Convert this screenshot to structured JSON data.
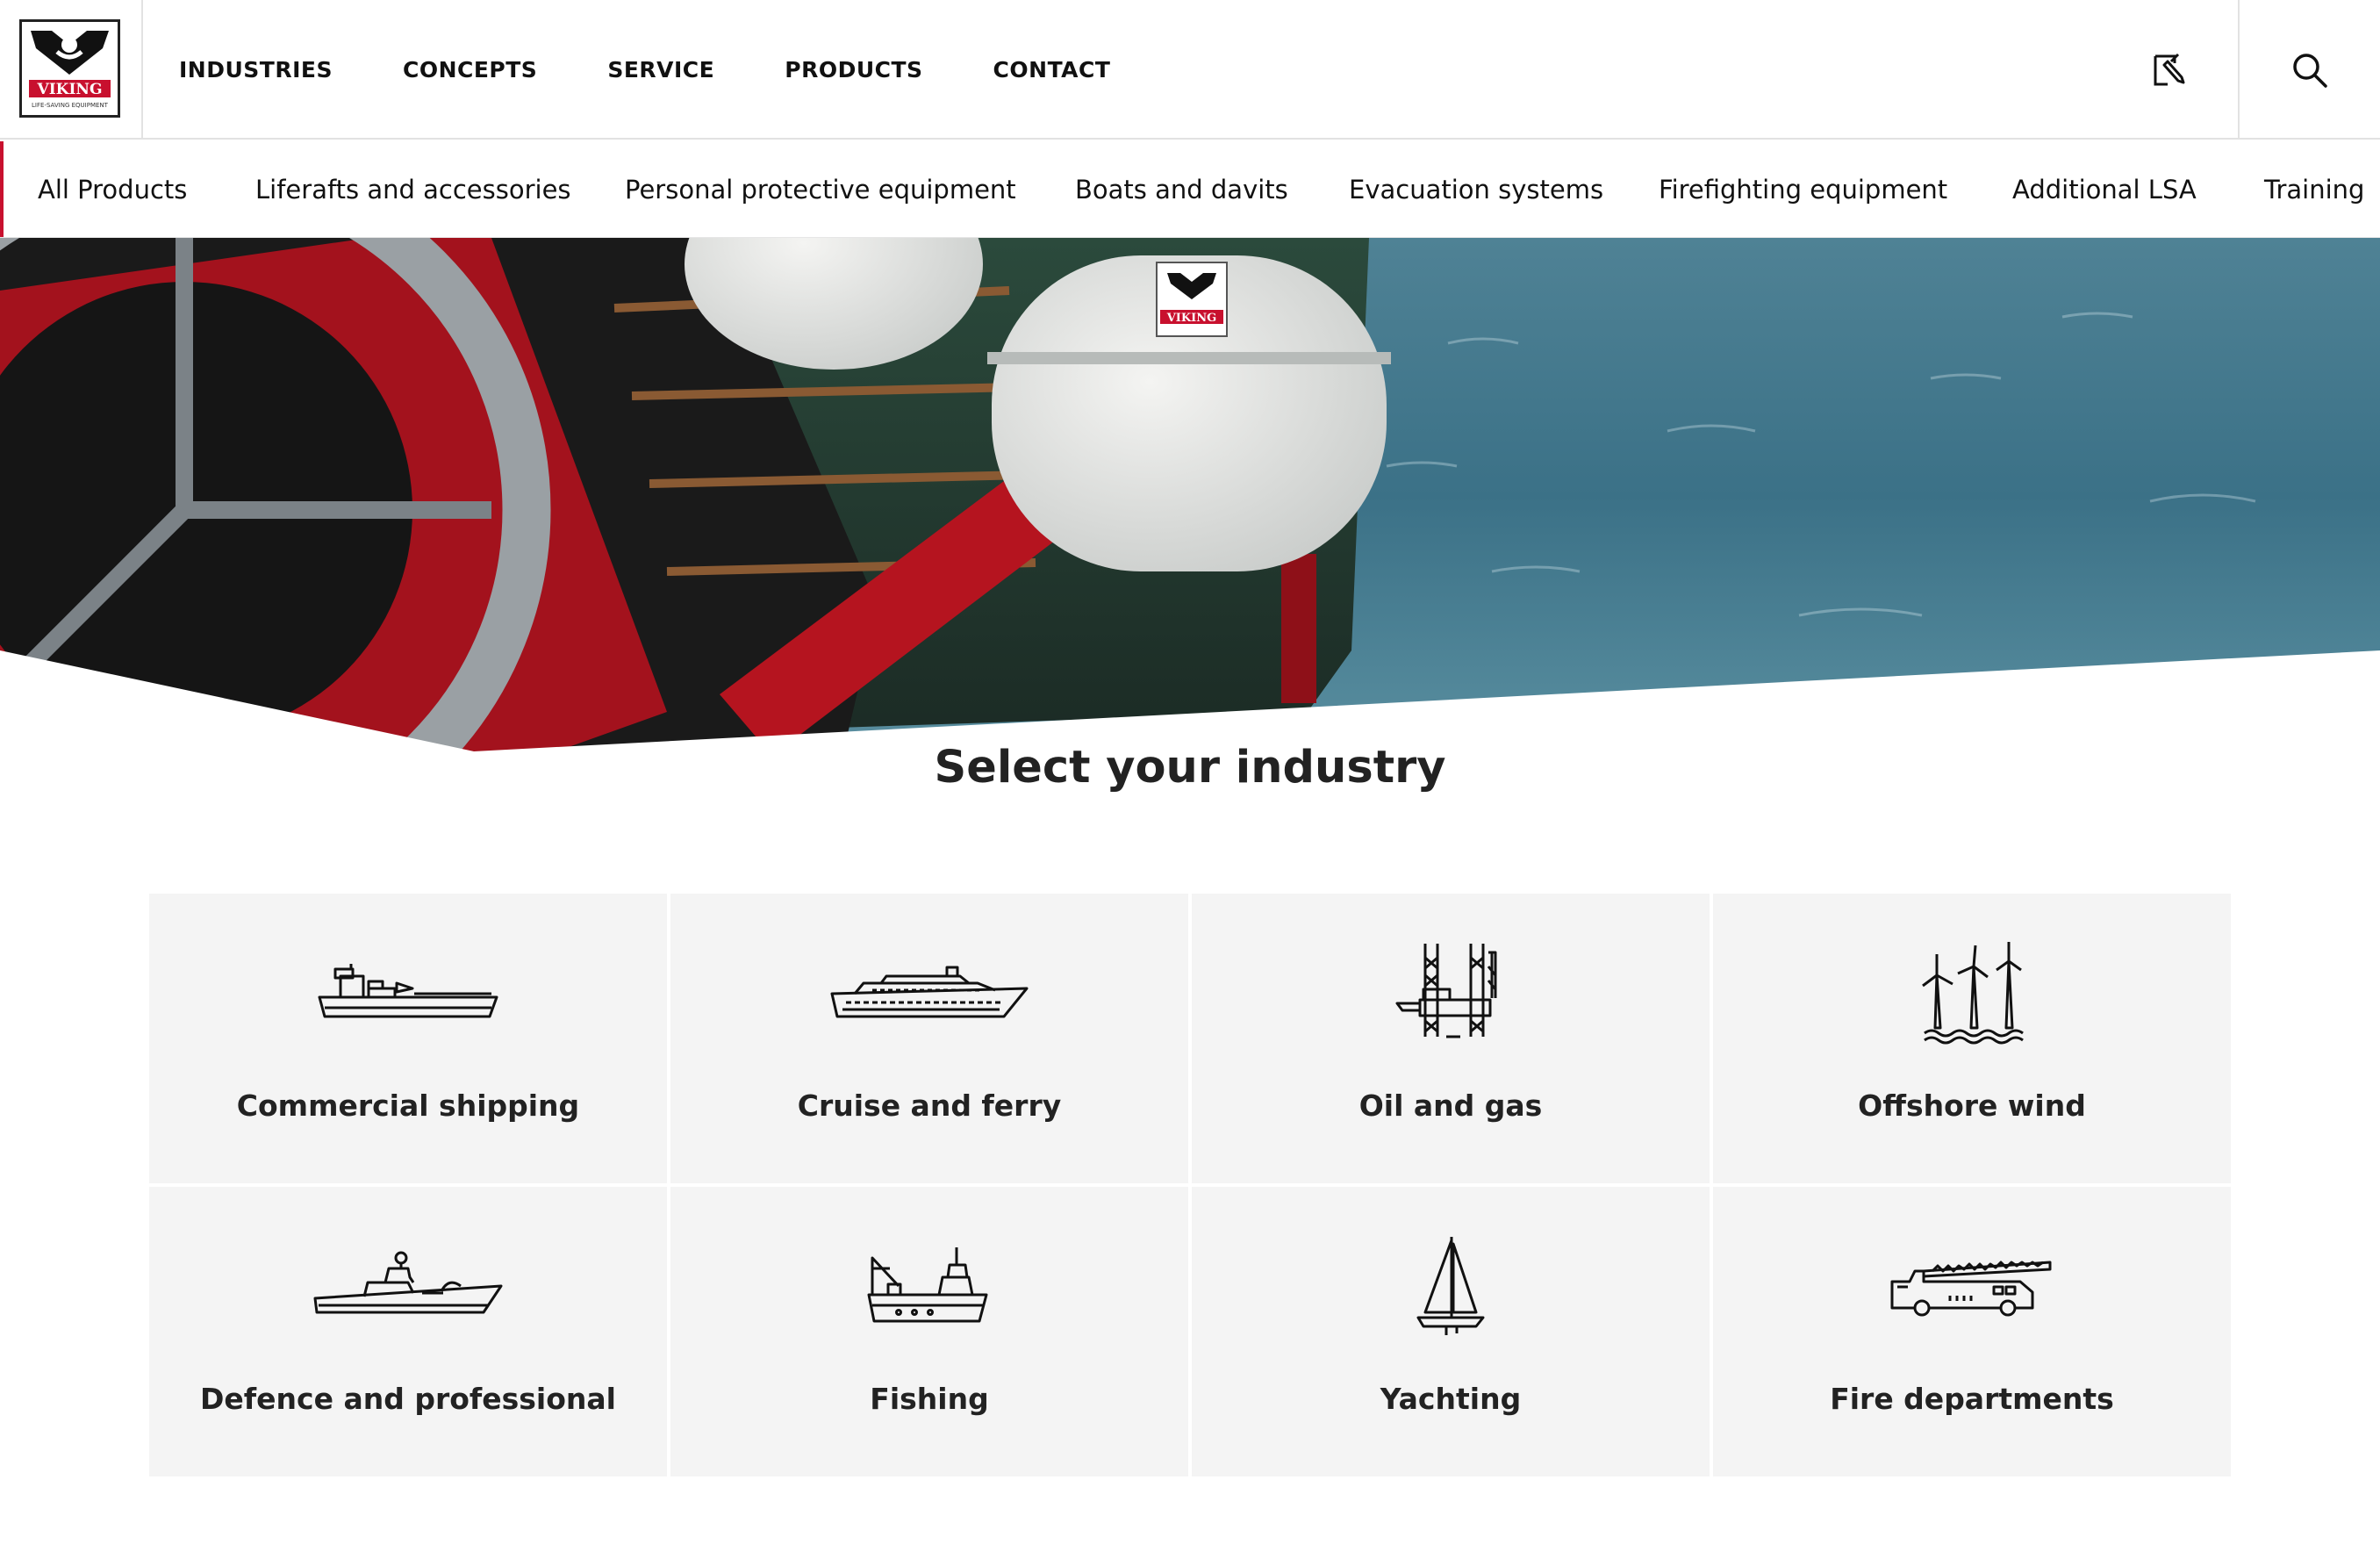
{
  "header": {
    "logo": {
      "brand_text": "VIKING",
      "tagline": "LIFE-SAVING EQUIPMENT",
      "icon": "viking-logo"
    },
    "nav": [
      {
        "label": "INDUSTRIES"
      },
      {
        "label": "CONCEPTS"
      },
      {
        "label": "SERVICE"
      },
      {
        "label": "PRODUCTS"
      },
      {
        "label": "CONTACT"
      }
    ],
    "icons": {
      "edit": "edit-document-icon",
      "search": "search-icon"
    }
  },
  "subnav": {
    "items": [
      {
        "label": "All Products"
      },
      {
        "label": "Liferafts and accessories"
      },
      {
        "label": "Personal protective equipment"
      },
      {
        "label": "Boats and davits"
      },
      {
        "label": "Evacuation systems"
      },
      {
        "label": "Firefighting equipment"
      },
      {
        "label": "Additional LSA"
      },
      {
        "label": "Training"
      }
    ]
  },
  "hero": {
    "raft_logo_text": "VIKING"
  },
  "main": {
    "title": "Select your industry",
    "industries": [
      {
        "label": "Commercial shipping",
        "icon": "cargo-ship-icon"
      },
      {
        "label": "Cruise and ferry",
        "icon": "cruise-ship-icon"
      },
      {
        "label": "Oil and gas",
        "icon": "oil-rig-icon"
      },
      {
        "label": "Offshore wind",
        "icon": "wind-turbine-icon"
      },
      {
        "label": "Defence and professional",
        "icon": "naval-vessel-icon"
      },
      {
        "label": "Fishing",
        "icon": "fishing-boat-icon"
      },
      {
        "label": "Yachting",
        "icon": "sailboat-icon"
      },
      {
        "label": "Fire departments",
        "icon": "fire-truck-icon"
      }
    ]
  },
  "colors": {
    "brand_red": "#c8102e",
    "tile_bg": "#f4f4f4",
    "text_dark": "#222222"
  }
}
